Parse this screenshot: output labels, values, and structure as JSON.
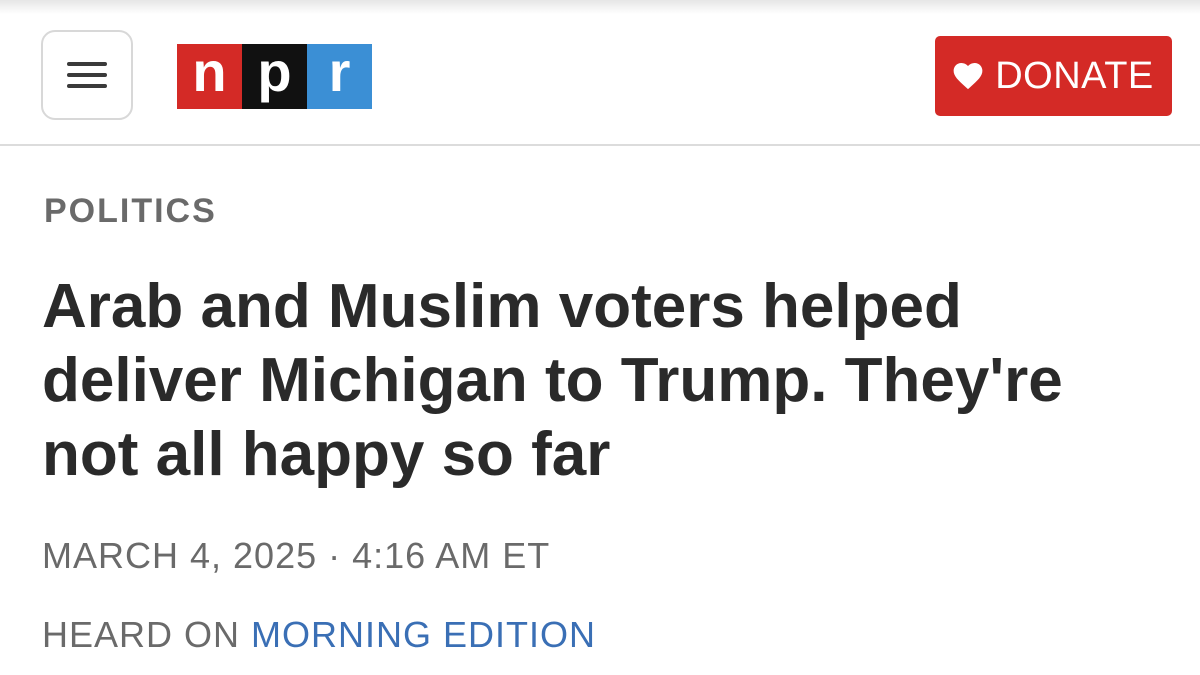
{
  "header": {
    "logo": {
      "letters": [
        "n",
        "p",
        "r"
      ],
      "colors": [
        "#d42a26",
        "#111111",
        "#3b8fd5"
      ]
    },
    "donate_label": "DONATE",
    "accent_color": "#d42a26",
    "icons": {
      "menu": "hamburger-icon",
      "donate": "heart-icon"
    }
  },
  "article": {
    "section": "POLITICS",
    "headline": "Arab and Muslim voters helped deliver Michigan to Trump. They're not all happy so far",
    "date": "MARCH 4, 2025",
    "separator": "·",
    "time": "4:16 AM ET",
    "heard_on_prefix": "HEARD ON",
    "program": "MORNING EDITION",
    "link_color": "#3a6fb5"
  }
}
